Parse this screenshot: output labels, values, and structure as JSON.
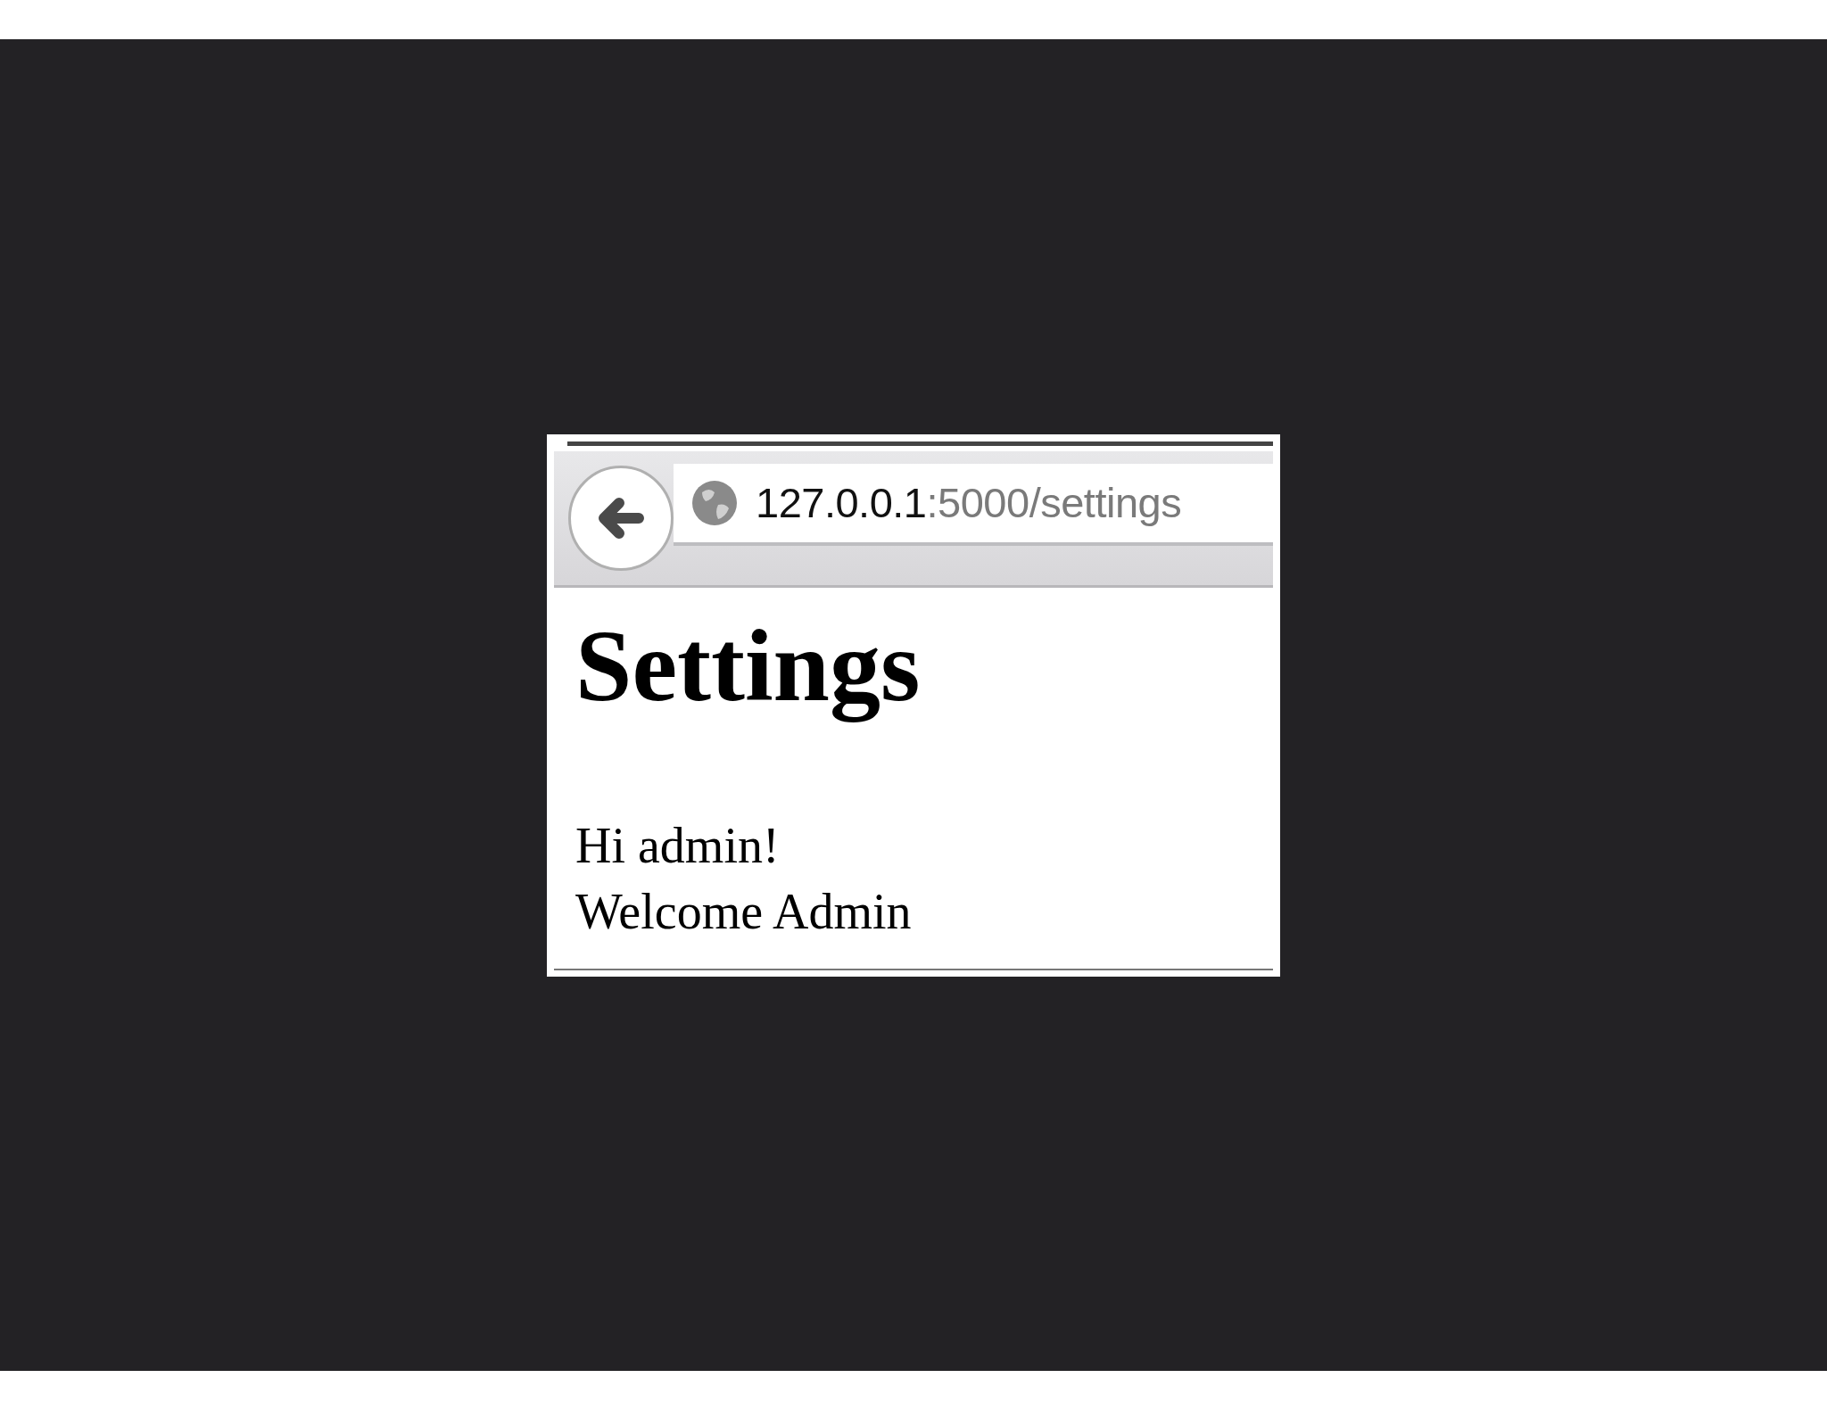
{
  "browser": {
    "url_host": "127.0.0.1",
    "url_path": ":5000/settings"
  },
  "page": {
    "heading": "Settings",
    "lines": [
      "Hi admin!",
      "Welcome Admin"
    ]
  }
}
